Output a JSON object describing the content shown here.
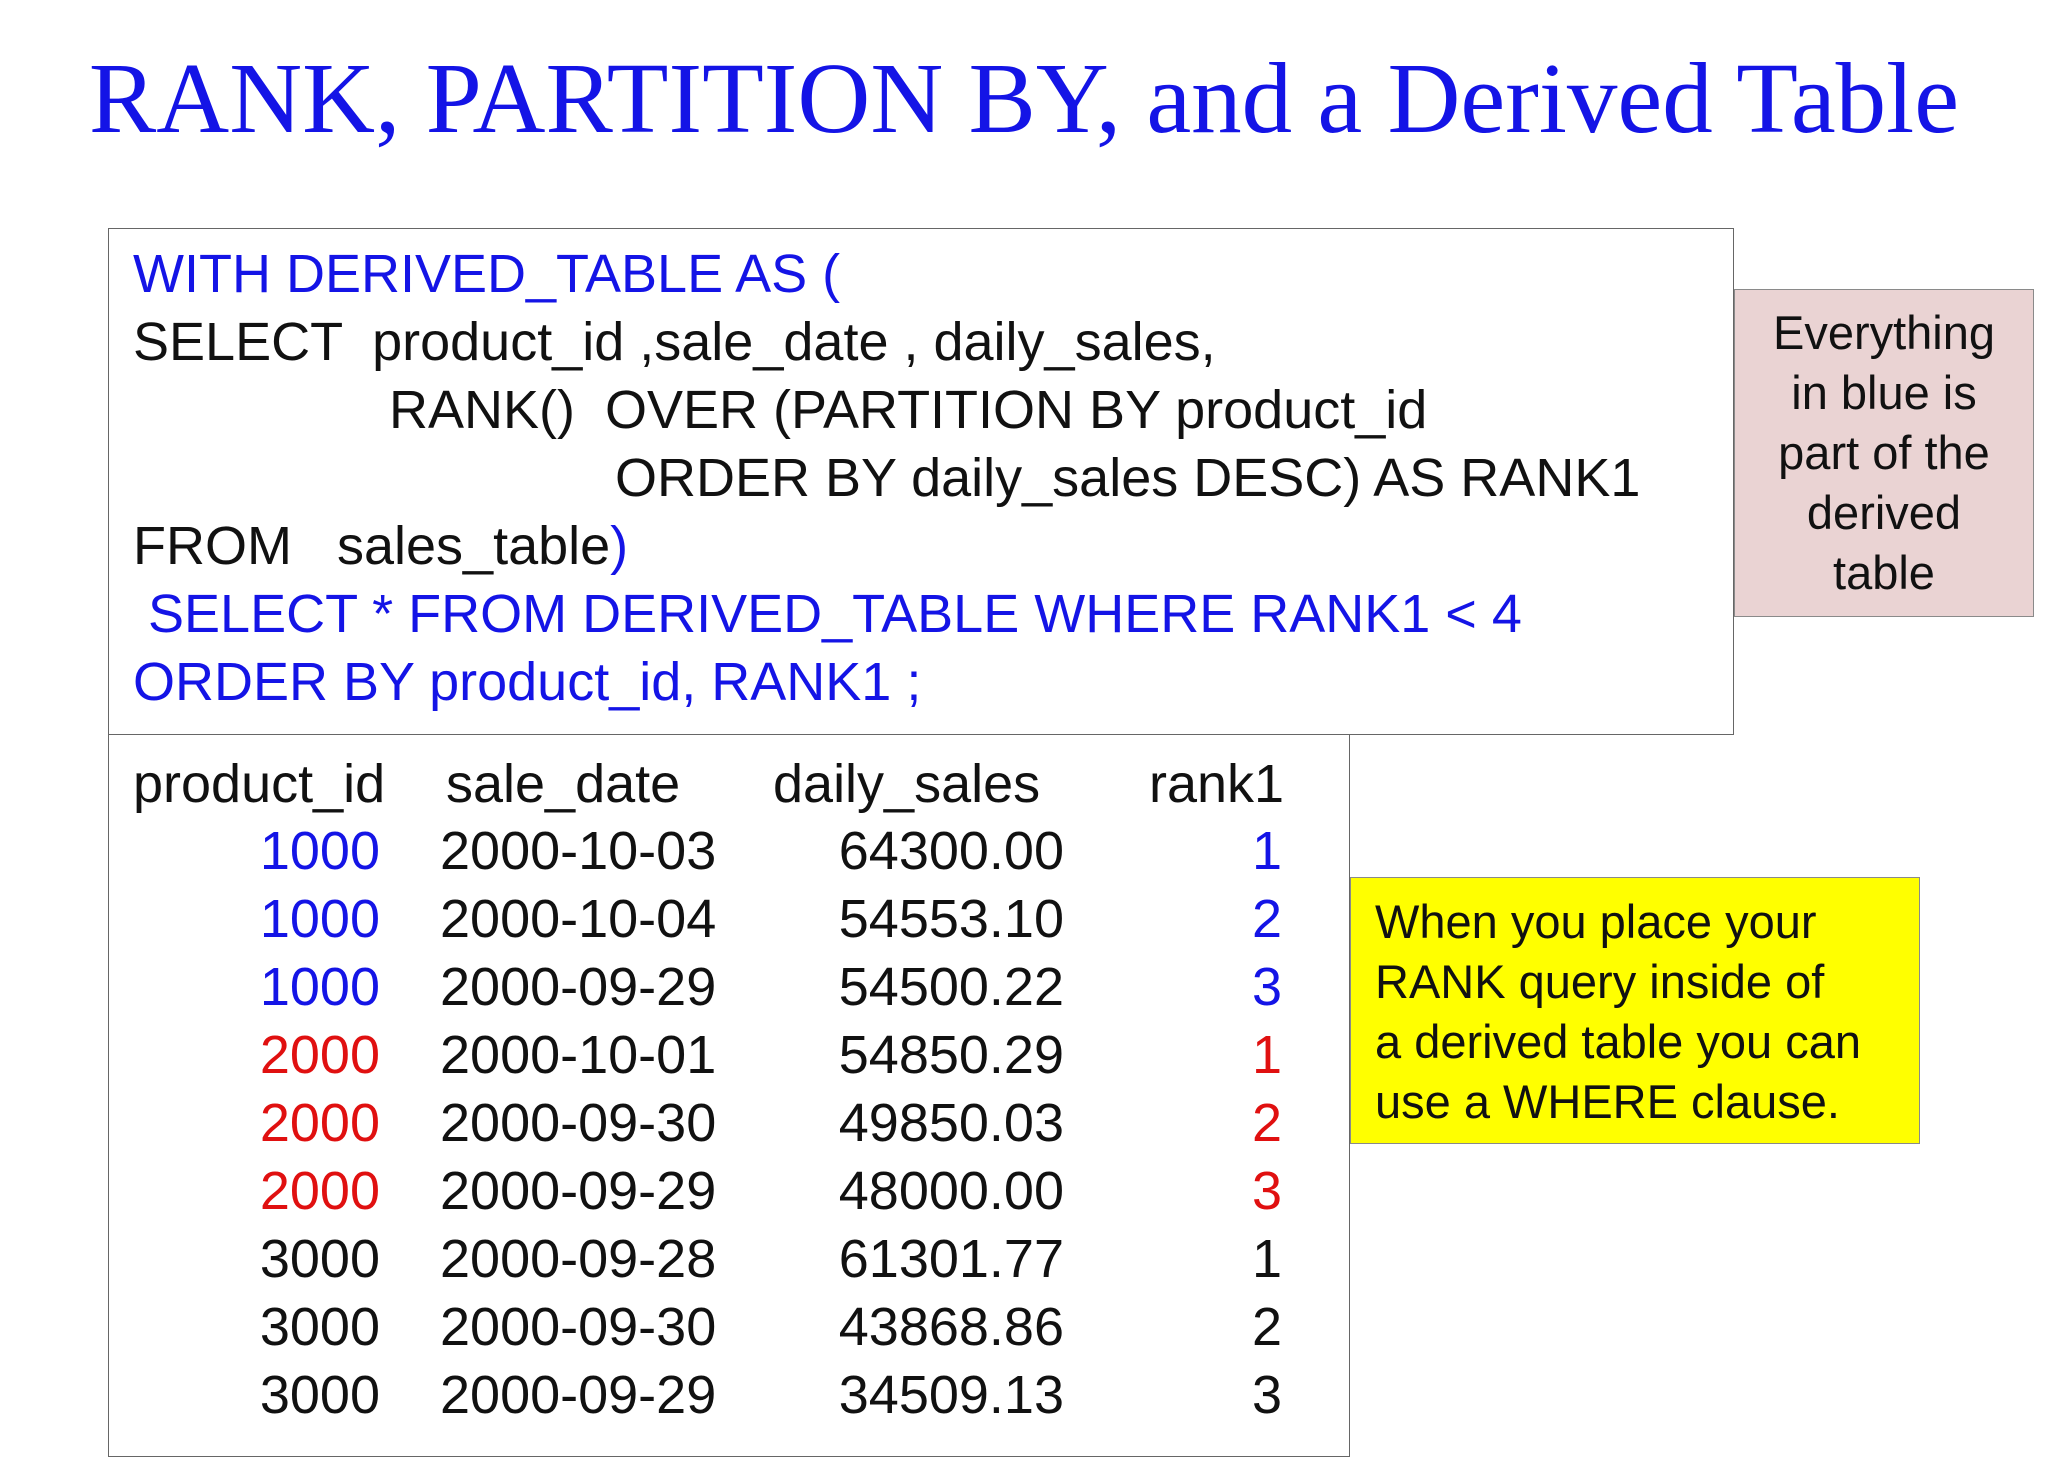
{
  "title": "RANK, PARTITION BY, and a Derived Table",
  "sql": {
    "line1": "WITH DERIVED_TABLE AS (",
    "line2": "SELECT  product_id ,sale_date , daily_sales,",
    "line3": "RANK()  OVER (PARTITION BY product_id",
    "line4": "ORDER BY daily_sales DESC) AS RANK1",
    "line5_text": "FROM   sales_table",
    "line5_paren": ")",
    "line6": " SELECT * FROM DERIVED_TABLE WHERE RANK1 < 4",
    "line7": "ORDER BY product_id, RANK1 ;"
  },
  "result": {
    "headers": [
      "product_id",
      "sale_date",
      "daily_sales",
      "rank1"
    ],
    "rows": [
      {
        "product_id": "1000",
        "sale_date": "2000-10-03",
        "daily_sales": "64300.00",
        "rank1": "1",
        "color": "#1414e6"
      },
      {
        "product_id": "1000",
        "sale_date": "2000-10-04",
        "daily_sales": "54553.10",
        "rank1": "2",
        "color": "#1414e6"
      },
      {
        "product_id": "1000",
        "sale_date": "2000-09-29",
        "daily_sales": "54500.22",
        "rank1": "3",
        "color": "#1414e6"
      },
      {
        "product_id": "2000",
        "sale_date": "2000-10-01",
        "daily_sales": "54850.29",
        "rank1": "1",
        "color": "#e01010"
      },
      {
        "product_id": "2000",
        "sale_date": "2000-09-30",
        "daily_sales": "49850.03",
        "rank1": "2",
        "color": "#e01010"
      },
      {
        "product_id": "2000",
        "sale_date": "2000-09-29",
        "daily_sales": "48000.00",
        "rank1": "3",
        "color": "#e01010"
      },
      {
        "product_id": "3000",
        "sale_date": "2000-09-28",
        "daily_sales": "61301.77",
        "rank1": "1",
        "color": "#111111"
      },
      {
        "product_id": "3000",
        "sale_date": "2000-09-30",
        "daily_sales": "43868.86",
        "rank1": "2",
        "color": "#111111"
      },
      {
        "product_id": "3000",
        "sale_date": "2000-09-29",
        "daily_sales": "34509.13",
        "rank1": "3",
        "color": "#111111"
      }
    ]
  },
  "notes": {
    "pink": "Everything\nin blue is\npart of the\nderived\ntable",
    "yellow": "When you place your\nRANK query inside of\na derived table you can\nuse a WHERE clause."
  },
  "colors": {
    "title": "#1414e6",
    "blue": "#1414e6",
    "red": "#e01010",
    "black": "#111111",
    "pink_note": "#ead3d3",
    "yellow_note": "#ffff00"
  }
}
